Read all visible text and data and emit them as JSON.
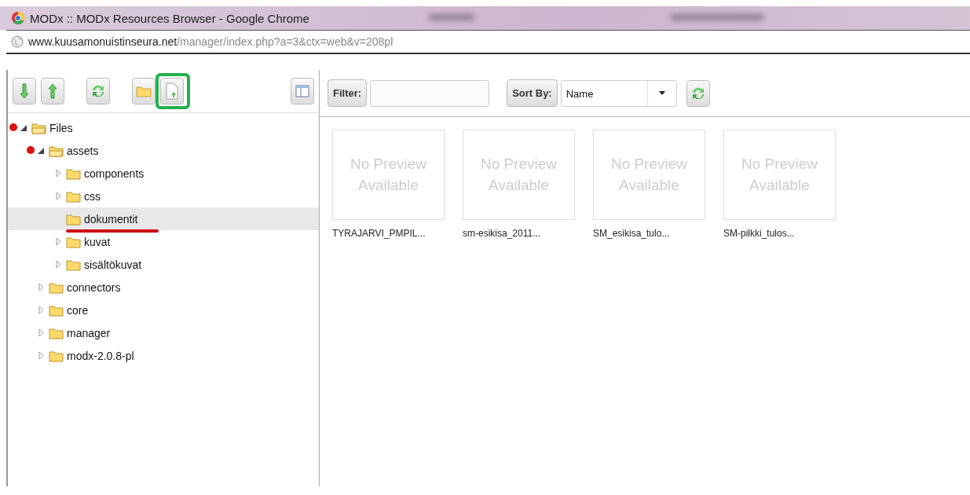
{
  "window": {
    "title": "MODx :: MODx Resources Browser - Google Chrome"
  },
  "address_bar": {
    "host": "www.kuusamonuistinseura.net",
    "path": "/manager/index.php?a=3&ctx=web&v=208pl"
  },
  "tree": [
    {
      "label": "Files",
      "expanded": true,
      "selected": false,
      "children": [
        {
          "label": "assets",
          "expanded": true,
          "selected": false,
          "children": [
            {
              "label": "components",
              "expanded": false,
              "selected": false
            },
            {
              "label": "css",
              "expanded": false,
              "selected": false
            },
            {
              "label": "dokumentit",
              "expanded": false,
              "selected": true,
              "leaf": true
            },
            {
              "label": "kuvat",
              "expanded": false,
              "selected": false
            },
            {
              "label": "sisältökuvat",
              "expanded": false,
              "selected": false
            }
          ]
        },
        {
          "label": "connectors",
          "expanded": false,
          "selected": false
        },
        {
          "label": "core",
          "expanded": false,
          "selected": false
        },
        {
          "label": "manager",
          "expanded": false,
          "selected": false
        },
        {
          "label": "modx-2.0.8-pl",
          "expanded": false,
          "selected": false
        }
      ]
    }
  ],
  "filter": {
    "label": "Filter:"
  },
  "sort": {
    "label": "Sort By:",
    "value": "Name"
  },
  "files": [
    {
      "preview": "No Preview Available",
      "name": "TYRAJARVI_PMPIL..."
    },
    {
      "preview": "No Preview Available",
      "name": "sm-esikisa_2011..."
    },
    {
      "preview": "No Preview Available",
      "name": "SM_esikisa_tulo..."
    },
    {
      "preview": "No Preview Available",
      "name": "SM-pilkki_tulos..."
    }
  ]
}
